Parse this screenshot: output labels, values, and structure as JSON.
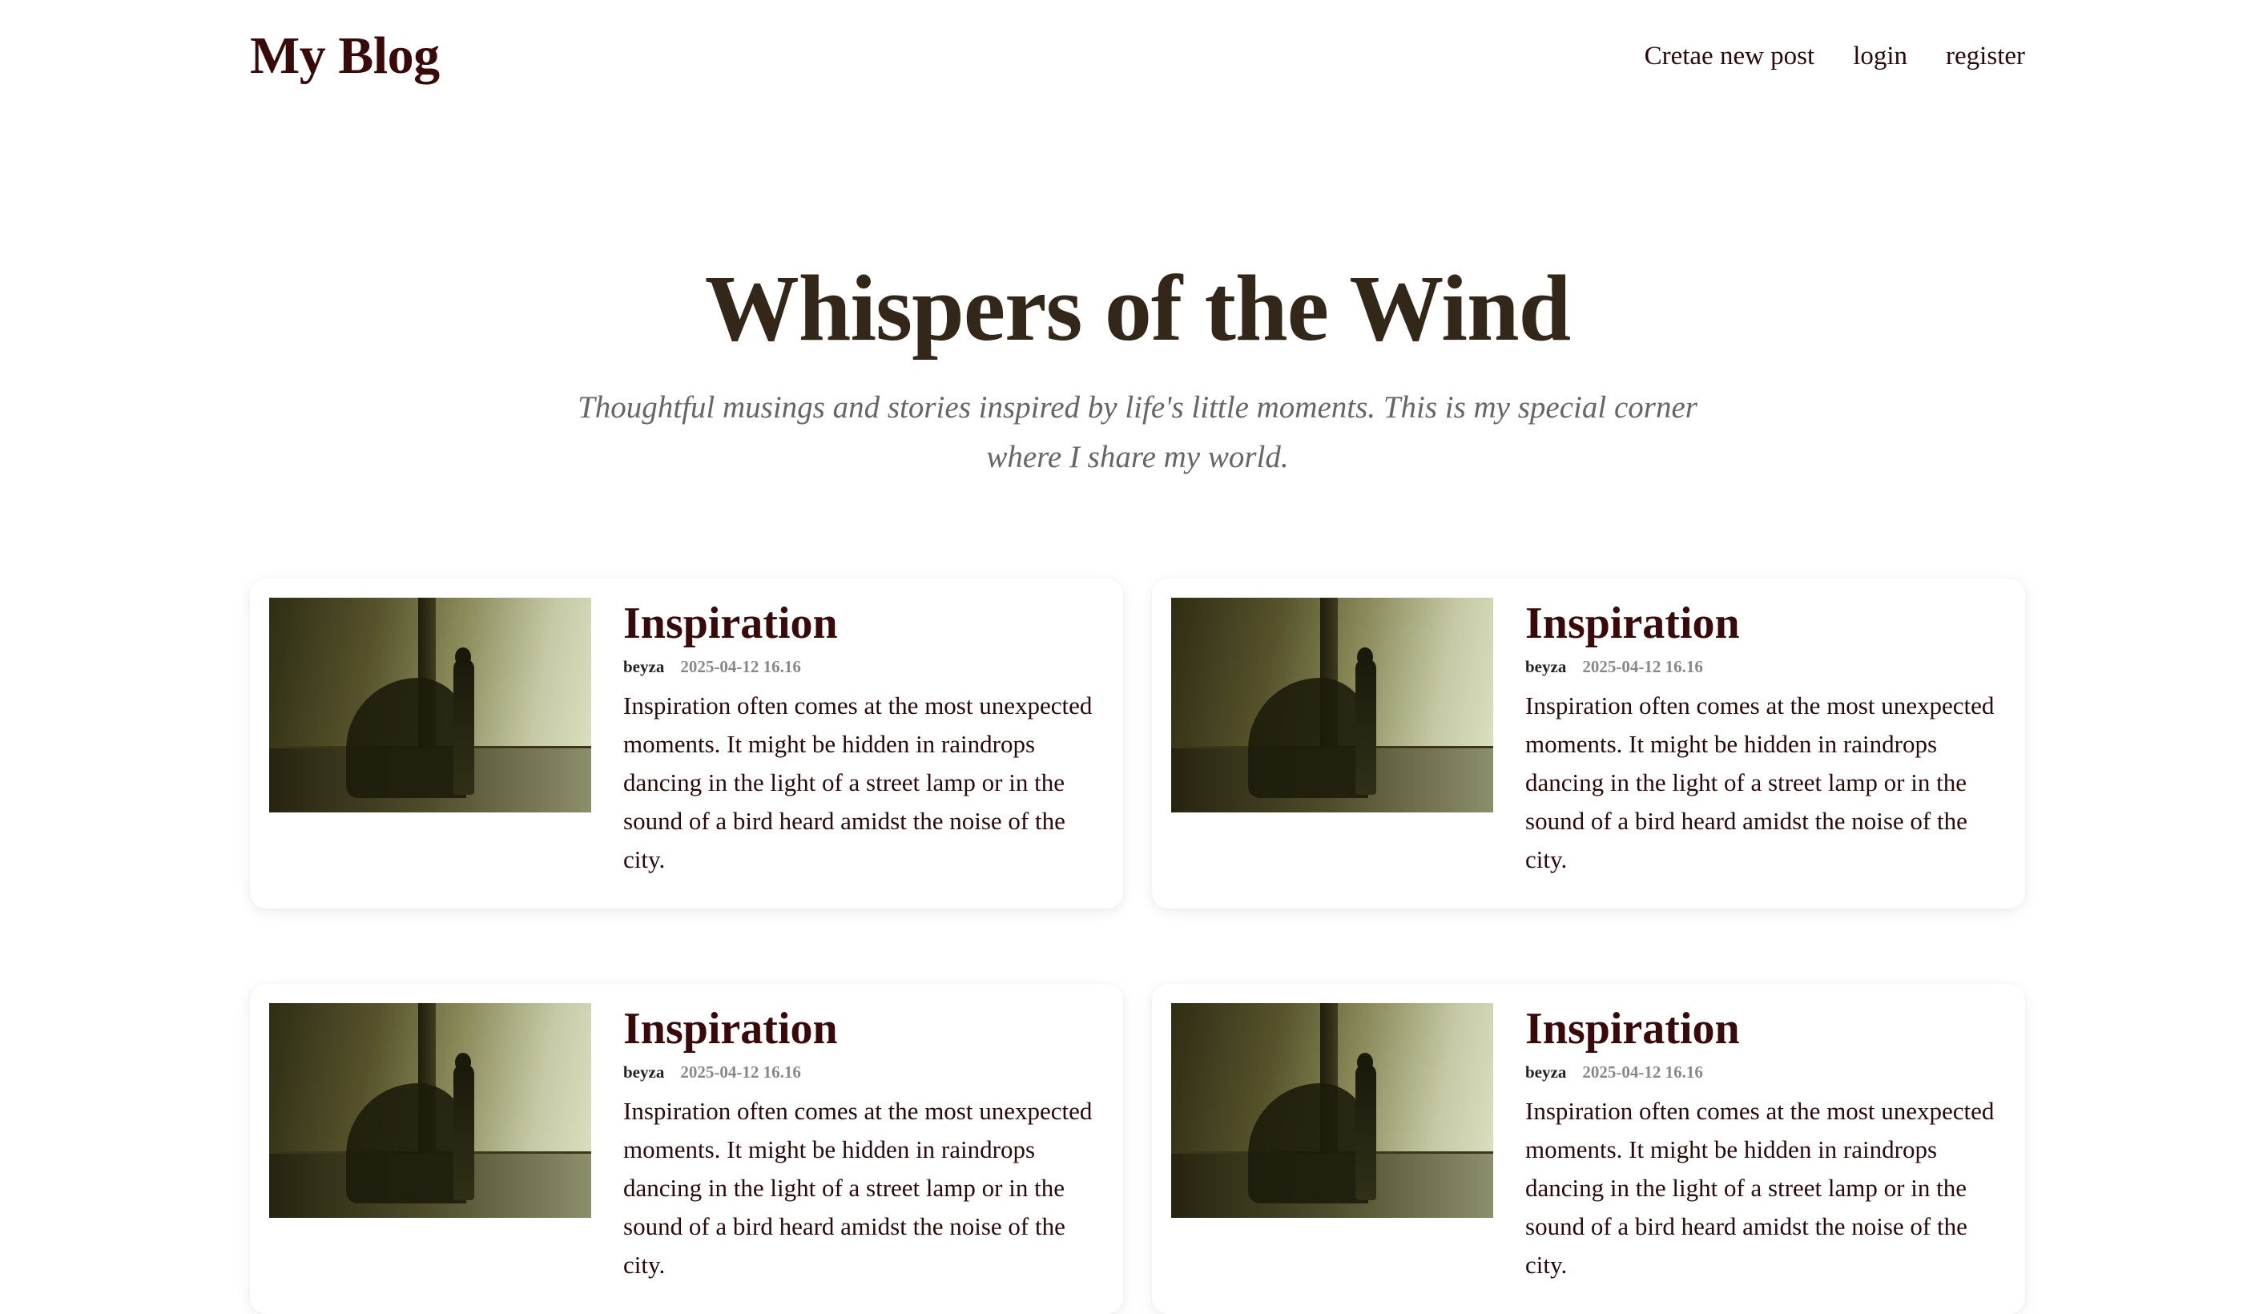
{
  "header": {
    "logo": "My Blog",
    "nav": [
      "Cretae new post",
      "login",
      "register"
    ]
  },
  "hero": {
    "title": "Whispers of the Wind",
    "subtitle": "Thoughtful musings and stories inspired by life's little moments. This is my special corner where I share my world."
  },
  "posts": [
    {
      "title": "Inspiration",
      "author": "beyza",
      "date": "2025-04-12 16.16",
      "excerpt": "Inspiration often comes at the most unexpected moments. It might be hidden in raindrops dancing in the light of a street lamp or in the sound of a bird heard amidst the noise of the city."
    },
    {
      "title": "Inspiration",
      "author": "beyza",
      "date": "2025-04-12 16.16",
      "excerpt": "Inspiration often comes at the most unexpected moments. It might be hidden in raindrops dancing in the light of a street lamp or in the sound of a bird heard amidst the noise of the city."
    },
    {
      "title": "Inspiration",
      "author": "beyza",
      "date": "2025-04-12 16.16",
      "excerpt": "Inspiration often comes at the most unexpected moments. It might be hidden in raindrops dancing in the light of a street lamp or in the sound of a bird heard amidst the noise of the city."
    },
    {
      "title": "Inspiration",
      "author": "beyza",
      "date": "2025-04-12 16.16",
      "excerpt": "Inspiration often comes at the most unexpected moments. It might be hidden in raindrops dancing in the light of a street lamp or in the sound of a bird heard amidst the noise of the city."
    }
  ]
}
